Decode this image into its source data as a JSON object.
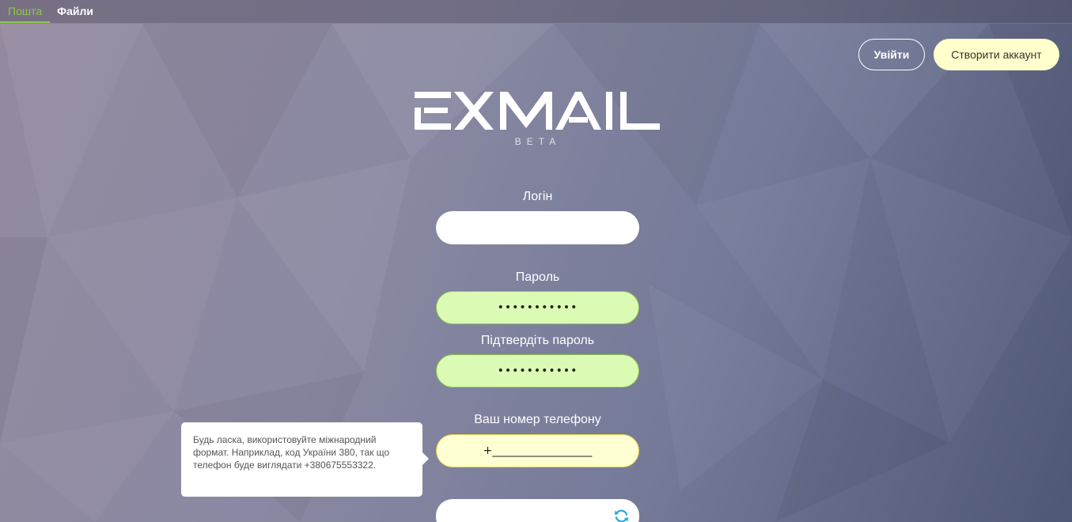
{
  "nav": {
    "tabs": [
      {
        "label": "Пошта",
        "active": true
      },
      {
        "label": "Файли",
        "active": false
      }
    ]
  },
  "header": {
    "login_button": "Увійти",
    "create_account_button": "Створити аккаунт"
  },
  "logo": {
    "text": "EXMAIL",
    "badge": "BETA"
  },
  "form": {
    "login": {
      "label": "Логін",
      "value": ""
    },
    "password": {
      "label": "Пароль",
      "value": "•••••••••••"
    },
    "confirm_password": {
      "label": "Підтвердіть пароль",
      "value": "•••••••••••"
    },
    "phone": {
      "label": "Ваш номер телефону",
      "value": "+__________________"
    }
  },
  "tooltip": {
    "text": "Будь ласка, використовуйте міжнародний формат. Наприклад, код України 380, так що телефон буде виглядати +380675553322."
  },
  "colors": {
    "accent_green": "#8fc94a",
    "create_button_bg": "#ffffcc",
    "password_field_bg": "#dbfbb4",
    "phone_field_bg": "#ffffd4",
    "refresh_icon": "#2aa8e0"
  }
}
